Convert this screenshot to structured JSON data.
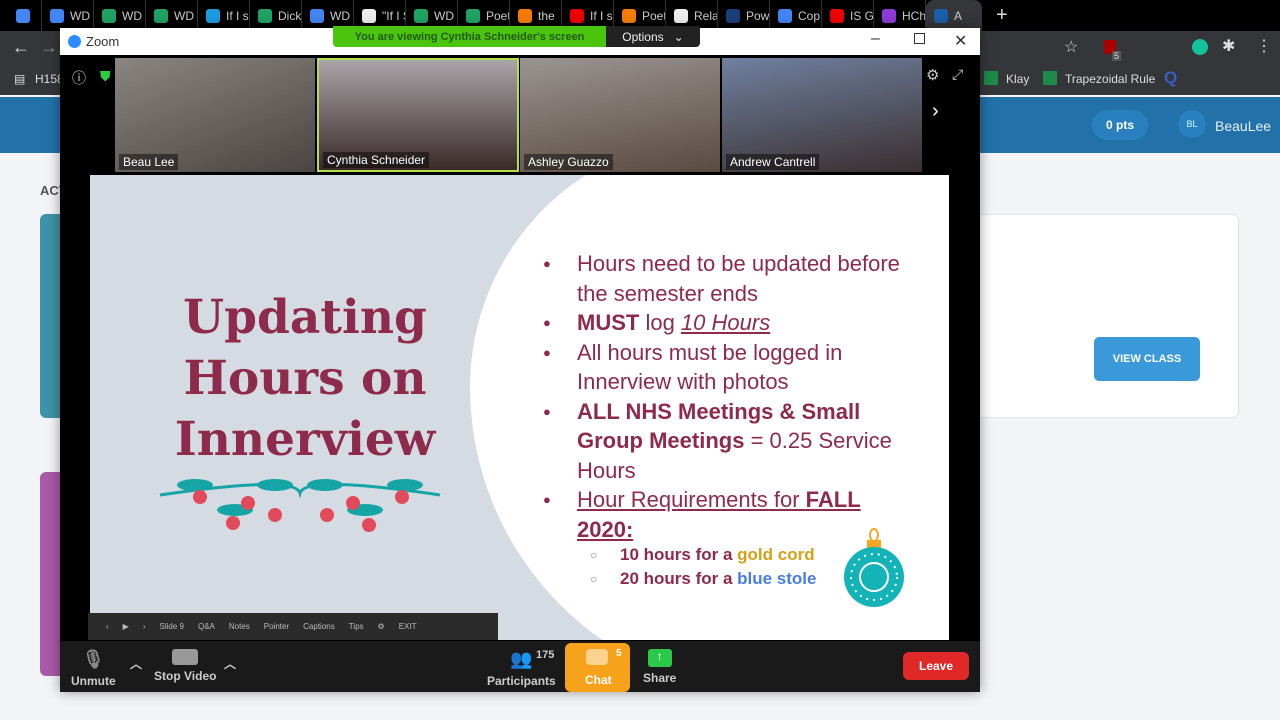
{
  "browser": {
    "tabs": [
      "",
      "WD",
      "WD",
      "WD",
      "If I s",
      "Dick",
      "WD",
      "\"If I S",
      "WD",
      "Poet",
      "the",
      "If I s",
      "Poet",
      "Rela",
      "Pow",
      "Cop",
      "IS G",
      "HCh",
      "A"
    ],
    "bookmarks": [
      "H158",
      "Klay",
      "Trapezoidal Rule"
    ],
    "ext_badge": "5"
  },
  "page": {
    "points": "0 pts",
    "avatar": "BL",
    "user": "BeauLee",
    "section": "ACT",
    "view_class": "VIEW CLASS",
    "accent": "#2271a8"
  },
  "zoom": {
    "title": "Zoom",
    "banner": "You are viewing Cynthia Schneider's screen",
    "options": "Options",
    "participants": [
      "Beau Lee",
      "Cynthia Schneider",
      "Ashley Guazzo",
      "Andrew Cantrell"
    ],
    "slide": {
      "title": "Updating Hours on Innerview",
      "b1": "Hours need to be updated before the semester ends",
      "b2a": "MUST",
      "b2b": " log ",
      "b2c": "10 Hours",
      "b3": "All hours must be logged in Innerview with photos",
      "b4a": "ALL NHS Meetings & Small Group Meetings",
      "b4b": " = 0.25 Service Hours",
      "b5a": "Hour Requirements for ",
      "b5b": "FALL 2020:",
      "s1a": "10 hours for a ",
      "s1b": "gold cord",
      "s2a": "20 hours for a ",
      "s2b": "blue stole"
    },
    "presenter": {
      "slide": "Slide 9",
      "qa": "Q&A",
      "notes": "Notes",
      "pointer": "Pointer",
      "captions": "Captions",
      "tips": "Tips",
      "exit": "EXIT"
    },
    "toolbar": {
      "unmute": "Unmute",
      "stop_video": "Stop Video",
      "participants": "Participants",
      "count": "175",
      "chat": "Chat",
      "chat_badge": "5",
      "share": "Share",
      "leave": "Leave"
    }
  }
}
